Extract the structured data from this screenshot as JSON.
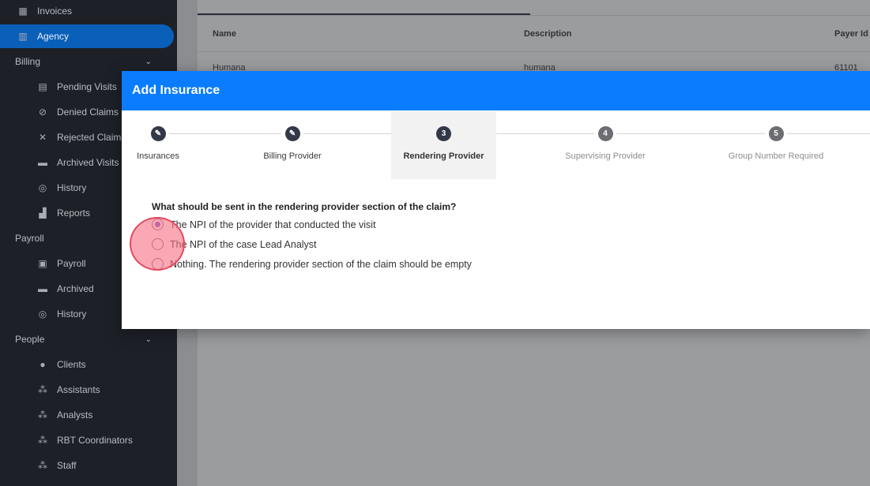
{
  "sidebar": {
    "items": [
      {
        "label": "Invoices",
        "icon": "building-icon",
        "type": "top"
      },
      {
        "label": "Agency",
        "icon": "agency-icon",
        "type": "top",
        "active": true
      },
      {
        "label": "Billing",
        "type": "section"
      },
      {
        "label": "Pending Visits",
        "icon": "pending-icon",
        "type": "sub"
      },
      {
        "label": "Denied Claims",
        "icon": "block-icon",
        "type": "sub"
      },
      {
        "label": "Rejected Claims",
        "icon": "x-icon",
        "type": "sub"
      },
      {
        "label": "Archived Visits",
        "icon": "archive-icon",
        "type": "sub"
      },
      {
        "label": "History",
        "icon": "history-icon",
        "type": "sub"
      },
      {
        "label": "Reports",
        "icon": "chart-icon",
        "type": "sub"
      },
      {
        "label": "Payroll",
        "type": "section"
      },
      {
        "label": "Payroll",
        "icon": "payroll-icon",
        "type": "sub"
      },
      {
        "label": "Archived",
        "icon": "archive-icon",
        "type": "sub"
      },
      {
        "label": "History",
        "icon": "history-icon",
        "type": "sub"
      },
      {
        "label": "People",
        "type": "section"
      },
      {
        "label": "Clients",
        "icon": "person-icon",
        "type": "sub"
      },
      {
        "label": "Assistants",
        "icon": "group-icon",
        "type": "sub"
      },
      {
        "label": "Analysts",
        "icon": "group-icon",
        "type": "sub"
      },
      {
        "label": "RBT Coordinators",
        "icon": "group-icon",
        "type": "sub"
      },
      {
        "label": "Staff",
        "icon": "group-icon",
        "type": "sub"
      }
    ]
  },
  "table": {
    "headers": [
      "Name",
      "Description",
      "Payer Id"
    ],
    "rows": [
      [
        "Humana",
        "humana",
        "61101"
      ]
    ]
  },
  "modal": {
    "title": "Add Insurance",
    "steps": [
      {
        "label": "Insurances",
        "state": "done"
      },
      {
        "label": "Billing Provider",
        "state": "done"
      },
      {
        "label": "Rendering Provider",
        "number": "3",
        "state": "current"
      },
      {
        "label": "Supervising Provider",
        "number": "4",
        "state": "pending"
      },
      {
        "label": "Group Number Required",
        "number": "5",
        "state": "pending"
      }
    ],
    "question": "What should be sent in the rendering provider section of the claim?",
    "options": [
      {
        "label": "The NPI of the provider that conducted the visit",
        "selected": true
      },
      {
        "label": "The NPI of the case Lead Analyst",
        "selected": false
      },
      {
        "label": "Nothing. The rendering provider section of the claim should be empty",
        "selected": false
      }
    ]
  },
  "colors": {
    "accent": "#0a7cff",
    "sidebar": "#1d2027",
    "active": "#0a5fb8"
  }
}
